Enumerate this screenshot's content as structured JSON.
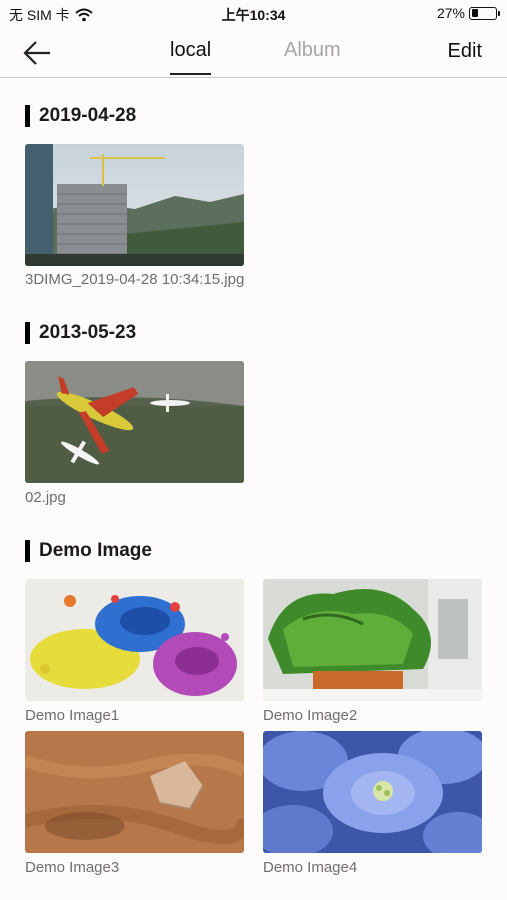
{
  "status_bar": {
    "carrier": "无 SIM 卡",
    "time": "上午10:34",
    "battery": "27%",
    "battery_level": 0.27,
    "wifi_icon": "wifi-icon"
  },
  "nav": {
    "tabs": [
      {
        "label": "local",
        "active": true
      },
      {
        "label": "Album",
        "active": false
      }
    ],
    "edit_label": "Edit",
    "back_icon": "arrow-left-icon"
  },
  "sections": [
    {
      "title": "2019-04-28",
      "items": [
        {
          "caption": "3DIMG_2019-04-28 10:34:15.jpg"
        }
      ]
    },
    {
      "title": "2013-05-23",
      "items": [
        {
          "caption": "02.jpg"
        }
      ]
    },
    {
      "title": "Demo Image",
      "items": [
        {
          "caption": "Demo Image1"
        },
        {
          "caption": "Demo Image2"
        },
        {
          "caption": "Demo Image3"
        },
        {
          "caption": "Demo Image4"
        }
      ]
    }
  ]
}
